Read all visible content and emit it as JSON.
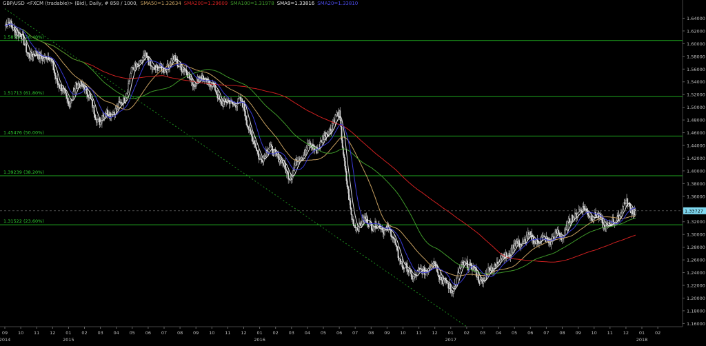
{
  "header": {
    "symbol": "GBP/USD <FXCM (tradable)> (Bid), Daily, # 858 / 1000,",
    "studies": [
      {
        "label": "SMA50=1.32634",
        "color": "#c8a060"
      },
      {
        "label": "SMA200=1.29609",
        "color": "#d02020"
      },
      {
        "label": "SMA100=1.31978",
        "color": "#3f9a2a"
      },
      {
        "label": "SMA9=1.33816",
        "color": "#e8e8e8"
      },
      {
        "label": "SMA20=1.33810",
        "color": "#3a3ad8"
      }
    ]
  },
  "chart_data": {
    "type": "candlestick",
    "title": "GBP/USD <FXCM (tradable)> (Bid), Daily, # 858 / 1000",
    "ylim": [
      1.155,
      1.66
    ],
    "y_ticks": [
      "1.64000",
      "1.62000",
      "1.60000",
      "1.58000",
      "1.56000",
      "1.54000",
      "1.52000",
      "1.50000",
      "1.48000",
      "1.46000",
      "1.44000",
      "1.42000",
      "1.40000",
      "1.38000",
      "1.36000",
      "1.34000",
      "1.32000",
      "1.30000",
      "1.28000",
      "1.26000",
      "1.24000",
      "1.22000",
      "1.20000",
      "1.18000",
      "1.16000"
    ],
    "x_ticks": [
      {
        "label": "09",
        "year": "2014"
      },
      {
        "label": "10"
      },
      {
        "label": "11"
      },
      {
        "label": "12"
      },
      {
        "label": "01",
        "year": "2015"
      },
      {
        "label": "02"
      },
      {
        "label": "03"
      },
      {
        "label": "04"
      },
      {
        "label": "05"
      },
      {
        "label": "06"
      },
      {
        "label": "07"
      },
      {
        "label": "08"
      },
      {
        "label": "09"
      },
      {
        "label": "10"
      },
      {
        "label": "11"
      },
      {
        "label": "12"
      },
      {
        "label": "01",
        "year": "2016"
      },
      {
        "label": "02"
      },
      {
        "label": "03"
      },
      {
        "label": "04"
      },
      {
        "label": "05"
      },
      {
        "label": "06"
      },
      {
        "label": "07"
      },
      {
        "label": "08"
      },
      {
        "label": "09"
      },
      {
        "label": "10"
      },
      {
        "label": "11"
      },
      {
        "label": "12"
      },
      {
        "label": "01",
        "year": "2017"
      },
      {
        "label": "02"
      },
      {
        "label": "03"
      },
      {
        "label": "04"
      },
      {
        "label": "05"
      },
      {
        "label": "06"
      },
      {
        "label": "07"
      },
      {
        "label": "08"
      },
      {
        "label": "09"
      },
      {
        "label": "10"
      },
      {
        "label": "11"
      },
      {
        "label": "12"
      },
      {
        "label": "01",
        "year": "2018"
      },
      {
        "label": "02"
      }
    ],
    "price_path": [
      [
        "2014-09",
        1.628
      ],
      [
        "2014-10",
        1.61
      ],
      [
        "2014-11",
        1.58
      ],
      [
        "2014-12",
        1.565
      ],
      [
        "2015-01",
        1.51
      ],
      [
        "2015-02",
        1.535
      ],
      [
        "2015-03",
        1.48
      ],
      [
        "2015-04",
        1.49
      ],
      [
        "2015-05",
        1.56
      ],
      [
        "2015-06",
        1.57
      ],
      [
        "2015-07",
        1.565
      ],
      [
        "2015-08",
        1.565
      ],
      [
        "2015-09",
        1.545
      ],
      [
        "2015-10",
        1.53
      ],
      [
        "2015-11",
        1.51
      ],
      [
        "2015-12",
        1.495
      ],
      [
        "2016-01",
        1.425
      ],
      [
        "2016-02",
        1.425
      ],
      [
        "2016-03",
        1.4
      ],
      [
        "2016-04",
        1.43
      ],
      [
        "2016-05",
        1.455
      ],
      [
        "2016-06",
        1.48
      ],
      [
        "2016-06-24",
        1.33
      ],
      [
        "2016-07",
        1.32
      ],
      [
        "2016-08",
        1.31
      ],
      [
        "2016-09",
        1.32
      ],
      [
        "2016-10",
        1.24
      ],
      [
        "2016-11",
        1.245
      ],
      [
        "2016-12",
        1.245
      ],
      [
        "2017-01",
        1.22
      ],
      [
        "2017-02",
        1.25
      ],
      [
        "2017-03",
        1.235
      ],
      [
        "2017-04",
        1.25
      ],
      [
        "2017-05",
        1.29
      ],
      [
        "2017-06",
        1.285
      ],
      [
        "2017-07",
        1.3
      ],
      [
        "2017-08",
        1.29
      ],
      [
        "2017-09",
        1.35
      ],
      [
        "2017-10",
        1.32
      ],
      [
        "2017-11",
        1.32
      ],
      [
        "2017-12",
        1.34
      ],
      [
        "2017-12-20",
        1.33727
      ]
    ],
    "last_price": "1.33727",
    "fibonacci": [
      {
        "label": "1.58588 (76.40%)",
        "value": 1.605
      },
      {
        "label": "1.51713 (61.80%)",
        "value": 1.51713
      },
      {
        "label": "1.45476 (50.00%)",
        "value": 1.45476
      },
      {
        "label": "1.39239 (38.20%)",
        "value": 1.39239
      },
      {
        "label": "1.31522 (23.60%)",
        "value": 1.31522
      }
    ],
    "trend_line": [
      [
        "2014-09",
        1.655
      ],
      [
        "2017-02",
        1.155
      ]
    ],
    "moving_averages": [
      {
        "name": "SMA50",
        "color": "#c8a060"
      },
      {
        "name": "SMA200",
        "color": "#d02020"
      },
      {
        "name": "SMA100",
        "color": "#3f9a2a"
      },
      {
        "name": "SMA9",
        "color": "#e8e8e8"
      },
      {
        "name": "SMA20",
        "color": "#3a3ad8"
      }
    ],
    "colors": {
      "fib": "#1fa81f",
      "fib_text": "#2fcf2f",
      "trend": "#1d8a1d",
      "candle": "#d8d8d8",
      "last_box": "#7fd8f0",
      "axis_text": "#bfbfbf"
    },
    "grid": false,
    "legend": "top-left"
  }
}
